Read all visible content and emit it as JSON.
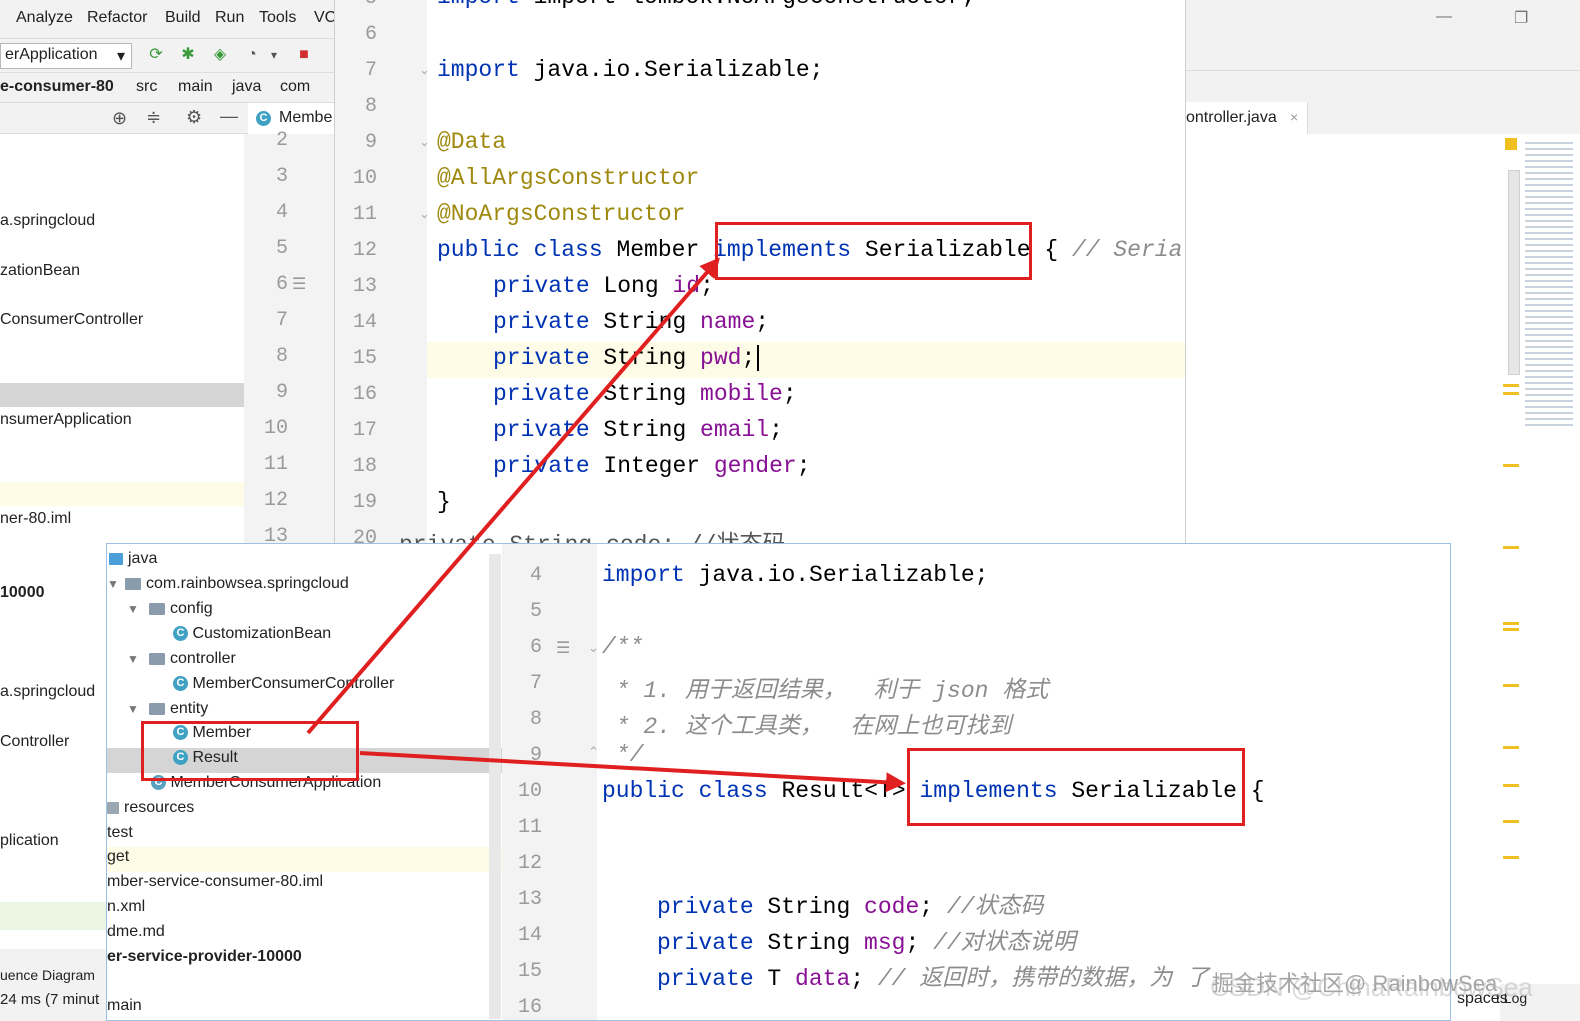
{
  "menu": {
    "analyze": "Analyze",
    "refactor": "Refactor",
    "build": "Build",
    "run": "Run",
    "tools": "Tools",
    "vcs_partial": "VC"
  },
  "window": {
    "minimize": "—",
    "restore": "❐"
  },
  "toolbar": {
    "run_config": "erApplication"
  },
  "breadcrumb": {
    "module": "e-consumer-80",
    "src": "src",
    "main": "main",
    "java": "java",
    "com": "com"
  },
  "tabs": {
    "member_partial": "Membe",
    "controller_partial": "ontroller.java",
    "close": "×"
  },
  "sidebar": {
    "items": [
      "a.springcloud",
      "zationBean",
      "ConsumerController",
      "nsumerApplication",
      "ner-80.iml",
      "10000",
      "a.springcloud",
      "Controller",
      "plication",
      "uence Diagram",
      "24 ms (7 minut"
    ]
  },
  "gutter_a": {
    "lines": [
      "2",
      "3",
      "4",
      "5",
      "6",
      "7",
      "8",
      "9",
      "10",
      "11",
      "12",
      "13"
    ]
  },
  "panel_a": {
    "line_numbers": [
      "5",
      "6",
      "7",
      "8",
      "9",
      "10",
      "11",
      "12",
      "13",
      "14",
      "15",
      "16",
      "17",
      "18",
      "19",
      "20"
    ],
    "line5": "import lombok.NoArgsConstructor;",
    "line7_kw": "import",
    "line7_rest": " java.io.Serializable;",
    "line9": "@Data",
    "line10": "@AllArgsConstructor",
    "line11": "@NoArgsConstructor",
    "line12_kw": "public class",
    "line12_name": " Member ",
    "line12_impl": "implements",
    "line12_iface": " Serializable",
    "line12_rest": " { ",
    "line12_cmt": "// Seria",
    "fields": [
      {
        "kw": "private",
        "type": " Long ",
        "name": "id",
        "end": ";"
      },
      {
        "kw": "private",
        "type": " String ",
        "name": "name",
        "end": ";"
      },
      {
        "kw": "private",
        "type": " String ",
        "name": "pwd",
        "end": ";"
      },
      {
        "kw": "private",
        "type": " String ",
        "name": "mobile",
        "end": ";"
      },
      {
        "kw": "private",
        "type": " String ",
        "name": "email",
        "end": ";"
      },
      {
        "kw": "private",
        "type": " Integer ",
        "name": "gender",
        "end": ";"
      }
    ],
    "line19": "}",
    "line20": "private String code; //状态码"
  },
  "tree": {
    "java": "java",
    "package": "com.rainbowsea.springcloud",
    "config": "config",
    "customization": "CustomizationBean",
    "controller": "controller",
    "member_consumer_controller": "MemberConsumerController",
    "entity": "entity",
    "member": "Member",
    "result": "Result",
    "app": "MemberConsumerApplication",
    "resources": "resources",
    "test": "test",
    "target": "get",
    "iml": "mber-service-consumer-80.iml",
    "pom": "n.xml",
    "readme": "dme.md",
    "provider": "er-service-provider-10000",
    "main": "main",
    "class_badge": "C"
  },
  "panel_b": {
    "line_numbers": [
      "4",
      "5",
      "6",
      "7",
      "8",
      "9",
      "10",
      "11",
      "12",
      "13",
      "14",
      "15",
      "16"
    ],
    "line4_kw": "import",
    "line4_rest": " java.io.Serializable;",
    "line6": "/**",
    "line7": " * 1. 用于返回结果，  利于 json 格式",
    "line8": " * 2. 这个工具类，  在网上也可找到",
    "line9": " */",
    "line10_kw": "public class",
    "line10_name": " Result",
    "line10_gen": "<T>",
    "line10_impl": " implements",
    "line10_iface": " Serializable",
    "line10_rest": " {",
    "fields": [
      {
        "kw": "private",
        "type": " String ",
        "name": "code",
        "end": "; ",
        "cmt": "//状态码"
      },
      {
        "kw": "private",
        "type": " String ",
        "name": "msg",
        "end": "; ",
        "cmt": "//对状态说明"
      },
      {
        "kw": "private",
        "type": " T ",
        "name": "data",
        "end": "; ",
        "cmt": "// 返回时，携带的数据，为 了"
      }
    ]
  },
  "statusbar": {
    "spaces": "spaces",
    "log_partial": "t Log"
  },
  "watermark": {
    "text": "CSDN @ChinaRainbowSea",
    "overlay": "掘金技术社区@ RainbowSea"
  },
  "colors": {
    "keyword": "#0033b3",
    "annotation": "#9e880d",
    "field": "#871094",
    "comment": "#8c8c8c",
    "arrow": "#e02020"
  }
}
